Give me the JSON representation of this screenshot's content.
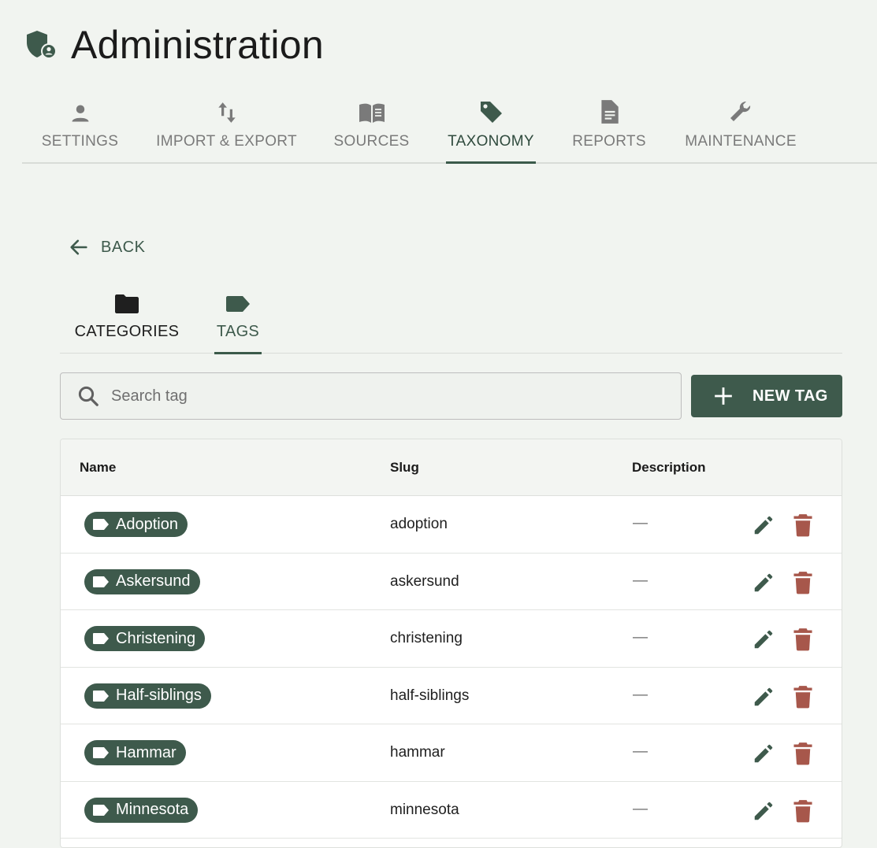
{
  "header": {
    "title": "Administration",
    "icon": "shield-account-icon"
  },
  "main_tabs": [
    {
      "label": "SETTINGS",
      "icon": "person-icon"
    },
    {
      "label": "IMPORT & EXPORT",
      "icon": "import-export-icon"
    },
    {
      "label": "SOURCES",
      "icon": "book-icon"
    },
    {
      "label": "TAXONOMY",
      "icon": "tag-icon",
      "active": true
    },
    {
      "label": "REPORTS",
      "icon": "document-icon"
    },
    {
      "label": "MAINTENANCE",
      "icon": "wrench-icon"
    }
  ],
  "back": {
    "label": "BACK"
  },
  "sub_tabs": [
    {
      "label": "CATEGORIES",
      "icon": "folder-icon"
    },
    {
      "label": "TAGS",
      "icon": "label-icon",
      "active": true
    }
  ],
  "search": {
    "placeholder": "Search tag",
    "value": ""
  },
  "new_tag": {
    "label": "NEW TAG"
  },
  "table": {
    "columns": [
      "Name",
      "Slug",
      "Description"
    ],
    "rows": [
      {
        "name": "Adoption",
        "slug": "adoption",
        "description": "—"
      },
      {
        "name": "Askersund",
        "slug": "askersund",
        "description": "—"
      },
      {
        "name": "Christening",
        "slug": "christening",
        "description": "—"
      },
      {
        "name": "Half-siblings",
        "slug": "half-siblings",
        "description": "—"
      },
      {
        "name": "Hammar",
        "slug": "hammar",
        "description": "—"
      },
      {
        "name": "Minnesota",
        "slug": "minnesota",
        "description": "—"
      }
    ]
  },
  "colors": {
    "accent": "#3e5a4c",
    "delete": "#a7574b",
    "background": "#f1f4f0"
  }
}
